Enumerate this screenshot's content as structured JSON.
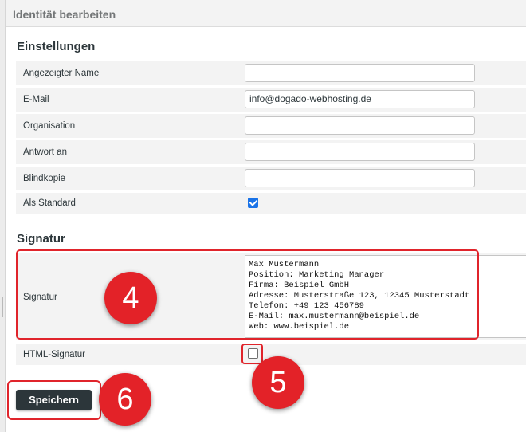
{
  "header": {
    "title": "Identität bearbeiten"
  },
  "settings": {
    "title": "Einstellungen",
    "fields": {
      "display_name": {
        "label": "Angezeigter Name",
        "value": ""
      },
      "email": {
        "label": "E-Mail",
        "value": "info@dogado-webhosting.de"
      },
      "organization": {
        "label": "Organisation",
        "value": ""
      },
      "reply_to": {
        "label": "Antwort an",
        "value": ""
      },
      "bcc": {
        "label": "Blindkopie",
        "value": ""
      },
      "default": {
        "label": "Als Standard",
        "checked": true
      }
    }
  },
  "signature": {
    "title": "Signatur",
    "label": "Signatur",
    "lines": [
      "Max Mustermann",
      "Position: Marketing Manager",
      "Firma: Beispiel GmbH",
      "Adresse: Musterstraße 123, 12345 Musterstadt",
      "Telefon: +49 123 456789",
      "E-Mail: max.mustermann@beispiel.de",
      "Web: www.beispiel.de"
    ],
    "html_signature": {
      "label": "HTML-Signatur",
      "checked": false
    }
  },
  "actions": {
    "save_label": "Speichern"
  },
  "annotations": {
    "step4": "4",
    "step5": "5",
    "step6": "6",
    "color": "#e32228"
  }
}
